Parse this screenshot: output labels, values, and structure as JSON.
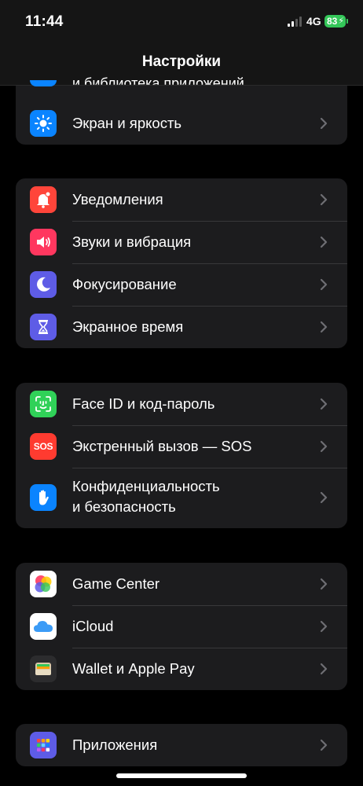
{
  "status": {
    "time": "11:44",
    "network": "4G",
    "battery": "83"
  },
  "nav": {
    "title": "Настройки",
    "peek_label": "и библиотека приложений"
  },
  "groups": [
    {
      "items": [
        {
          "label": "Экран и яркость",
          "icon": "sun-icon",
          "color": "#0a84ff"
        }
      ]
    },
    {
      "items": [
        {
          "label": "Уведомления",
          "icon": "bell-icon",
          "color": "#ff453a"
        },
        {
          "label": "Звуки и вибрация",
          "icon": "speaker-icon",
          "color": "#ff375f"
        },
        {
          "label": "Фокусирование",
          "icon": "moon-icon",
          "color": "#5e5ce6"
        },
        {
          "label": "Экранное время",
          "icon": "hourglass-icon",
          "color": "#5e5ce6"
        }
      ]
    },
    {
      "items": [
        {
          "label": "Face ID и код-пароль",
          "icon": "face-id-icon",
          "color": "#30d158"
        },
        {
          "label": "Экстренный вызов — SOS",
          "icon": "sos-icon",
          "color": "#ff3b30",
          "icon_text": "SOS"
        },
        {
          "label_line1": "Конфиденциальность",
          "label_line2": "и безопасность",
          "icon": "hand-icon",
          "color": "#0a84ff"
        }
      ]
    },
    {
      "items": [
        {
          "label": "Game Center",
          "icon": "game-center-icon",
          "color": "#ffffff"
        },
        {
          "label": "iCloud",
          "icon": "icloud-icon",
          "color": "#ffffff"
        },
        {
          "label": "Wallet и Apple Pay",
          "icon": "wallet-icon",
          "color": "#2c2c2e"
        }
      ]
    },
    {
      "items": [
        {
          "label": "Приложения",
          "icon": "apps-grid-icon",
          "color": "#5e5ce6"
        }
      ]
    }
  ]
}
